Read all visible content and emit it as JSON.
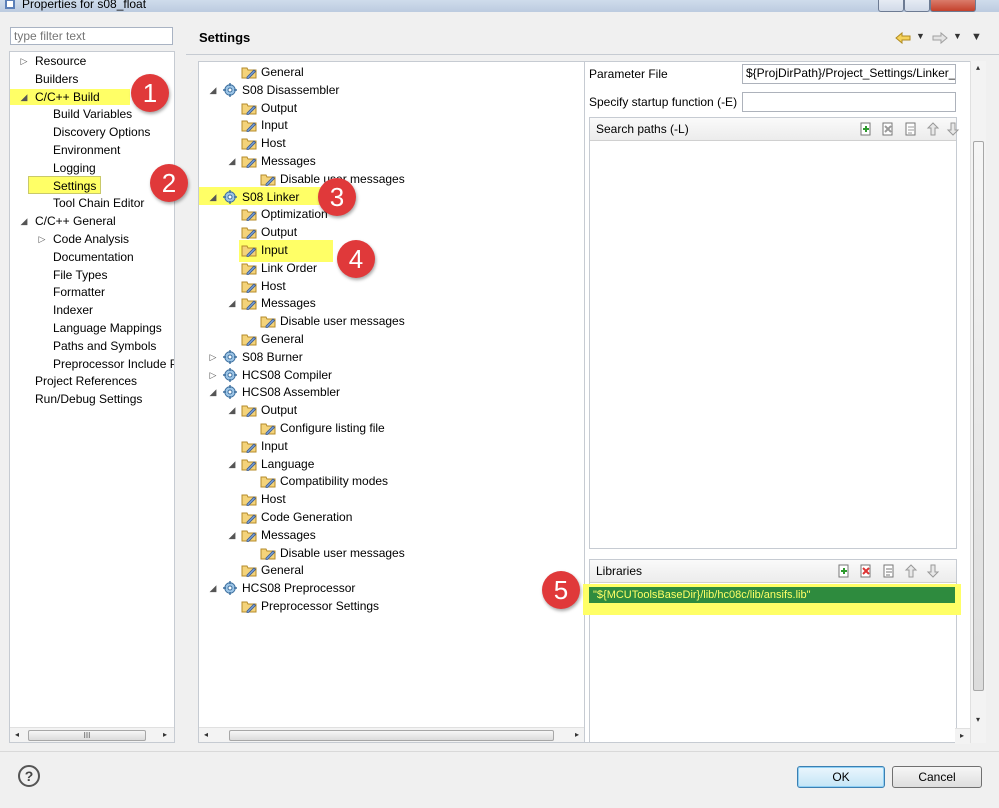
{
  "window": {
    "title": "Properties for s08_float"
  },
  "left": {
    "filter_placeholder": "type filter text",
    "tree": [
      {
        "label": "Resource",
        "level": 0,
        "twisty": "collapsed"
      },
      {
        "label": "Builders",
        "level": 0,
        "twisty": "none"
      },
      {
        "label": "C/C++ Build",
        "level": 0,
        "twisty": "expanded",
        "highlight": true
      },
      {
        "label": "Build Variables",
        "level": 1,
        "twisty": "none"
      },
      {
        "label": "Discovery Options",
        "level": 1,
        "twisty": "none"
      },
      {
        "label": "Environment",
        "level": 1,
        "twisty": "none"
      },
      {
        "label": "Logging",
        "level": 1,
        "twisty": "none"
      },
      {
        "label": "Settings",
        "level": 1,
        "twisty": "none",
        "selected": true
      },
      {
        "label": "Tool Chain Editor",
        "level": 1,
        "twisty": "none"
      },
      {
        "label": "C/C++ General",
        "level": 0,
        "twisty": "expanded"
      },
      {
        "label": "Code Analysis",
        "level": 1,
        "twisty": "collapsed"
      },
      {
        "label": "Documentation",
        "level": 1,
        "twisty": "none"
      },
      {
        "label": "File Types",
        "level": 1,
        "twisty": "none"
      },
      {
        "label": "Formatter",
        "level": 1,
        "twisty": "none"
      },
      {
        "label": "Indexer",
        "level": 1,
        "twisty": "none"
      },
      {
        "label": "Language Mappings",
        "level": 1,
        "twisty": "none"
      },
      {
        "label": "Paths and Symbols",
        "level": 1,
        "twisty": "none"
      },
      {
        "label": "Preprocessor Include Pa",
        "level": 1,
        "twisty": "none"
      },
      {
        "label": "Project References",
        "level": 0,
        "twisty": "none"
      },
      {
        "label": "Run/Debug Settings",
        "level": 0,
        "twisty": "none"
      }
    ]
  },
  "page": {
    "title": "Settings"
  },
  "tool_tree": [
    {
      "label": "General",
      "level": 1,
      "twisty": "none",
      "icon": "folder-settings-icon"
    },
    {
      "label": "S08 Disassembler",
      "level": 0,
      "twisty": "expanded",
      "icon": "tool-gear-icon"
    },
    {
      "label": "Output",
      "level": 1,
      "twisty": "none",
      "icon": "folder-settings-icon"
    },
    {
      "label": "Input",
      "level": 1,
      "twisty": "none",
      "icon": "folder-settings-icon"
    },
    {
      "label": "Host",
      "level": 1,
      "twisty": "none",
      "icon": "folder-settings-icon"
    },
    {
      "label": "Messages",
      "level": 1,
      "twisty": "expanded",
      "icon": "folder-settings-icon"
    },
    {
      "label": "Disable user messages",
      "level": 2,
      "twisty": "none",
      "icon": "folder-settings-icon"
    },
    {
      "label": "S08 Linker",
      "level": 0,
      "twisty": "expanded",
      "icon": "tool-gear-icon",
      "highlight": true
    },
    {
      "label": "Optimization",
      "level": 1,
      "twisty": "none",
      "icon": "folder-settings-icon"
    },
    {
      "label": "Output",
      "level": 1,
      "twisty": "none",
      "icon": "folder-settings-icon"
    },
    {
      "label": "Input",
      "level": 1,
      "twisty": "none",
      "icon": "folder-settings-icon",
      "selected": true
    },
    {
      "label": "Link Order",
      "level": 1,
      "twisty": "none",
      "icon": "folder-settings-icon"
    },
    {
      "label": "Host",
      "level": 1,
      "twisty": "none",
      "icon": "folder-settings-icon"
    },
    {
      "label": "Messages",
      "level": 1,
      "twisty": "expanded",
      "icon": "folder-settings-icon"
    },
    {
      "label": "Disable user messages",
      "level": 2,
      "twisty": "none",
      "icon": "folder-settings-icon"
    },
    {
      "label": "General",
      "level": 1,
      "twisty": "none",
      "icon": "folder-settings-icon"
    },
    {
      "label": "S08 Burner",
      "level": 0,
      "twisty": "collapsed",
      "icon": "tool-gear-icon"
    },
    {
      "label": "HCS08 Compiler",
      "level": 0,
      "twisty": "collapsed",
      "icon": "tool-gear-icon"
    },
    {
      "label": "HCS08 Assembler",
      "level": 0,
      "twisty": "expanded",
      "icon": "tool-gear-icon"
    },
    {
      "label": "Output",
      "level": 1,
      "twisty": "expanded",
      "icon": "folder-settings-icon"
    },
    {
      "label": "Configure listing file",
      "level": 2,
      "twisty": "none",
      "icon": "folder-settings-icon"
    },
    {
      "label": "Input",
      "level": 1,
      "twisty": "none",
      "icon": "folder-settings-icon"
    },
    {
      "label": "Language",
      "level": 1,
      "twisty": "expanded",
      "icon": "folder-settings-icon"
    },
    {
      "label": "Compatibility modes",
      "level": 2,
      "twisty": "none",
      "icon": "folder-settings-icon"
    },
    {
      "label": "Host",
      "level": 1,
      "twisty": "none",
      "icon": "folder-settings-icon"
    },
    {
      "label": "Code Generation",
      "level": 1,
      "twisty": "none",
      "icon": "folder-settings-icon"
    },
    {
      "label": "Messages",
      "level": 1,
      "twisty": "expanded",
      "icon": "folder-settings-icon"
    },
    {
      "label": "Disable user messages",
      "level": 2,
      "twisty": "none",
      "icon": "folder-settings-icon"
    },
    {
      "label": "General",
      "level": 1,
      "twisty": "none",
      "icon": "folder-settings-icon"
    },
    {
      "label": "HCS08 Preprocessor",
      "level": 0,
      "twisty": "expanded",
      "icon": "tool-gear-icon"
    },
    {
      "label": "Preprocessor Settings",
      "level": 1,
      "twisty": "none",
      "icon": "folder-settings-icon"
    }
  ],
  "options": {
    "parameter_file_label": "Parameter File",
    "parameter_file_value": "${ProjDirPath}/Project_Settings/Linker_F",
    "startup_label": "Specify startup function (-E)",
    "startup_value": "",
    "search_paths_label": "Search paths (-L)",
    "libraries_label": "Libraries",
    "libraries": [
      "\"${MCUToolsBaseDir}/lib/hc08c/lib/ansifs.lib\""
    ]
  },
  "buttons": {
    "ok": "OK",
    "cancel": "Cancel",
    "help": "?"
  },
  "scrollbar_grip": "III",
  "callouts": [
    "1",
    "2",
    "3",
    "4",
    "5"
  ],
  "colors": {
    "highlight": "#ffff66",
    "callout": "#e0393a",
    "library_selection": "#2e8b3e"
  }
}
